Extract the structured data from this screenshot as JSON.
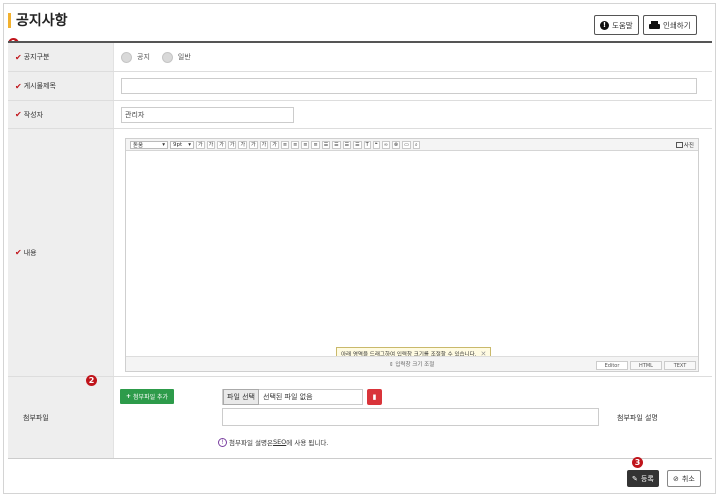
{
  "page": {
    "title": "공지사항"
  },
  "header_buttons": {
    "help": "도움말",
    "print": "인쇄하기"
  },
  "markers": [
    "1",
    "2",
    "3"
  ],
  "form": {
    "notice_type": {
      "label": "공지구분",
      "options": [
        "공지",
        "일반"
      ]
    },
    "subject": {
      "label": "게시물제목",
      "value": ""
    },
    "author": {
      "label": "작성자",
      "value": "관리자"
    },
    "content": {
      "label": "내용"
    },
    "attachment": {
      "label": "첨부파일"
    }
  },
  "editor": {
    "toolbar": {
      "font": "돋움",
      "size": "9pt",
      "buttons": [
        "가",
        "가",
        "가",
        "가",
        "가",
        "가",
        "가",
        "가",
        "≡",
        "≡",
        "≡",
        "≡",
        "☰",
        "☰",
        "☰",
        "☰",
        "T",
        "❝",
        "∞",
        "⊗",
        "▭",
        "⌕"
      ],
      "photo": "사진"
    },
    "tip": "아래 영역을 드래그하여 입력창 크기를 조절할 수 있습니다.",
    "resize_label": "입력창 크기 조절",
    "tabs": [
      "Editor",
      "HTML",
      "TEXT"
    ]
  },
  "attachment": {
    "add_button": "첨부파일 추가",
    "file_select": "파일 선택",
    "no_file": "선택된 파일 없음",
    "description_label": "첨부파일 설명",
    "note_prefix": "첨부파일 설명은 ",
    "note_link": "SEO",
    "note_suffix": "에 사용 됩니다."
  },
  "footer": {
    "register": "등록",
    "cancel": "취소"
  },
  "colors": {
    "accent": "#f2b12f",
    "required": "#c0141b",
    "green": "#2d9b4a",
    "delete": "#d9343a",
    "dark": "#333333"
  }
}
